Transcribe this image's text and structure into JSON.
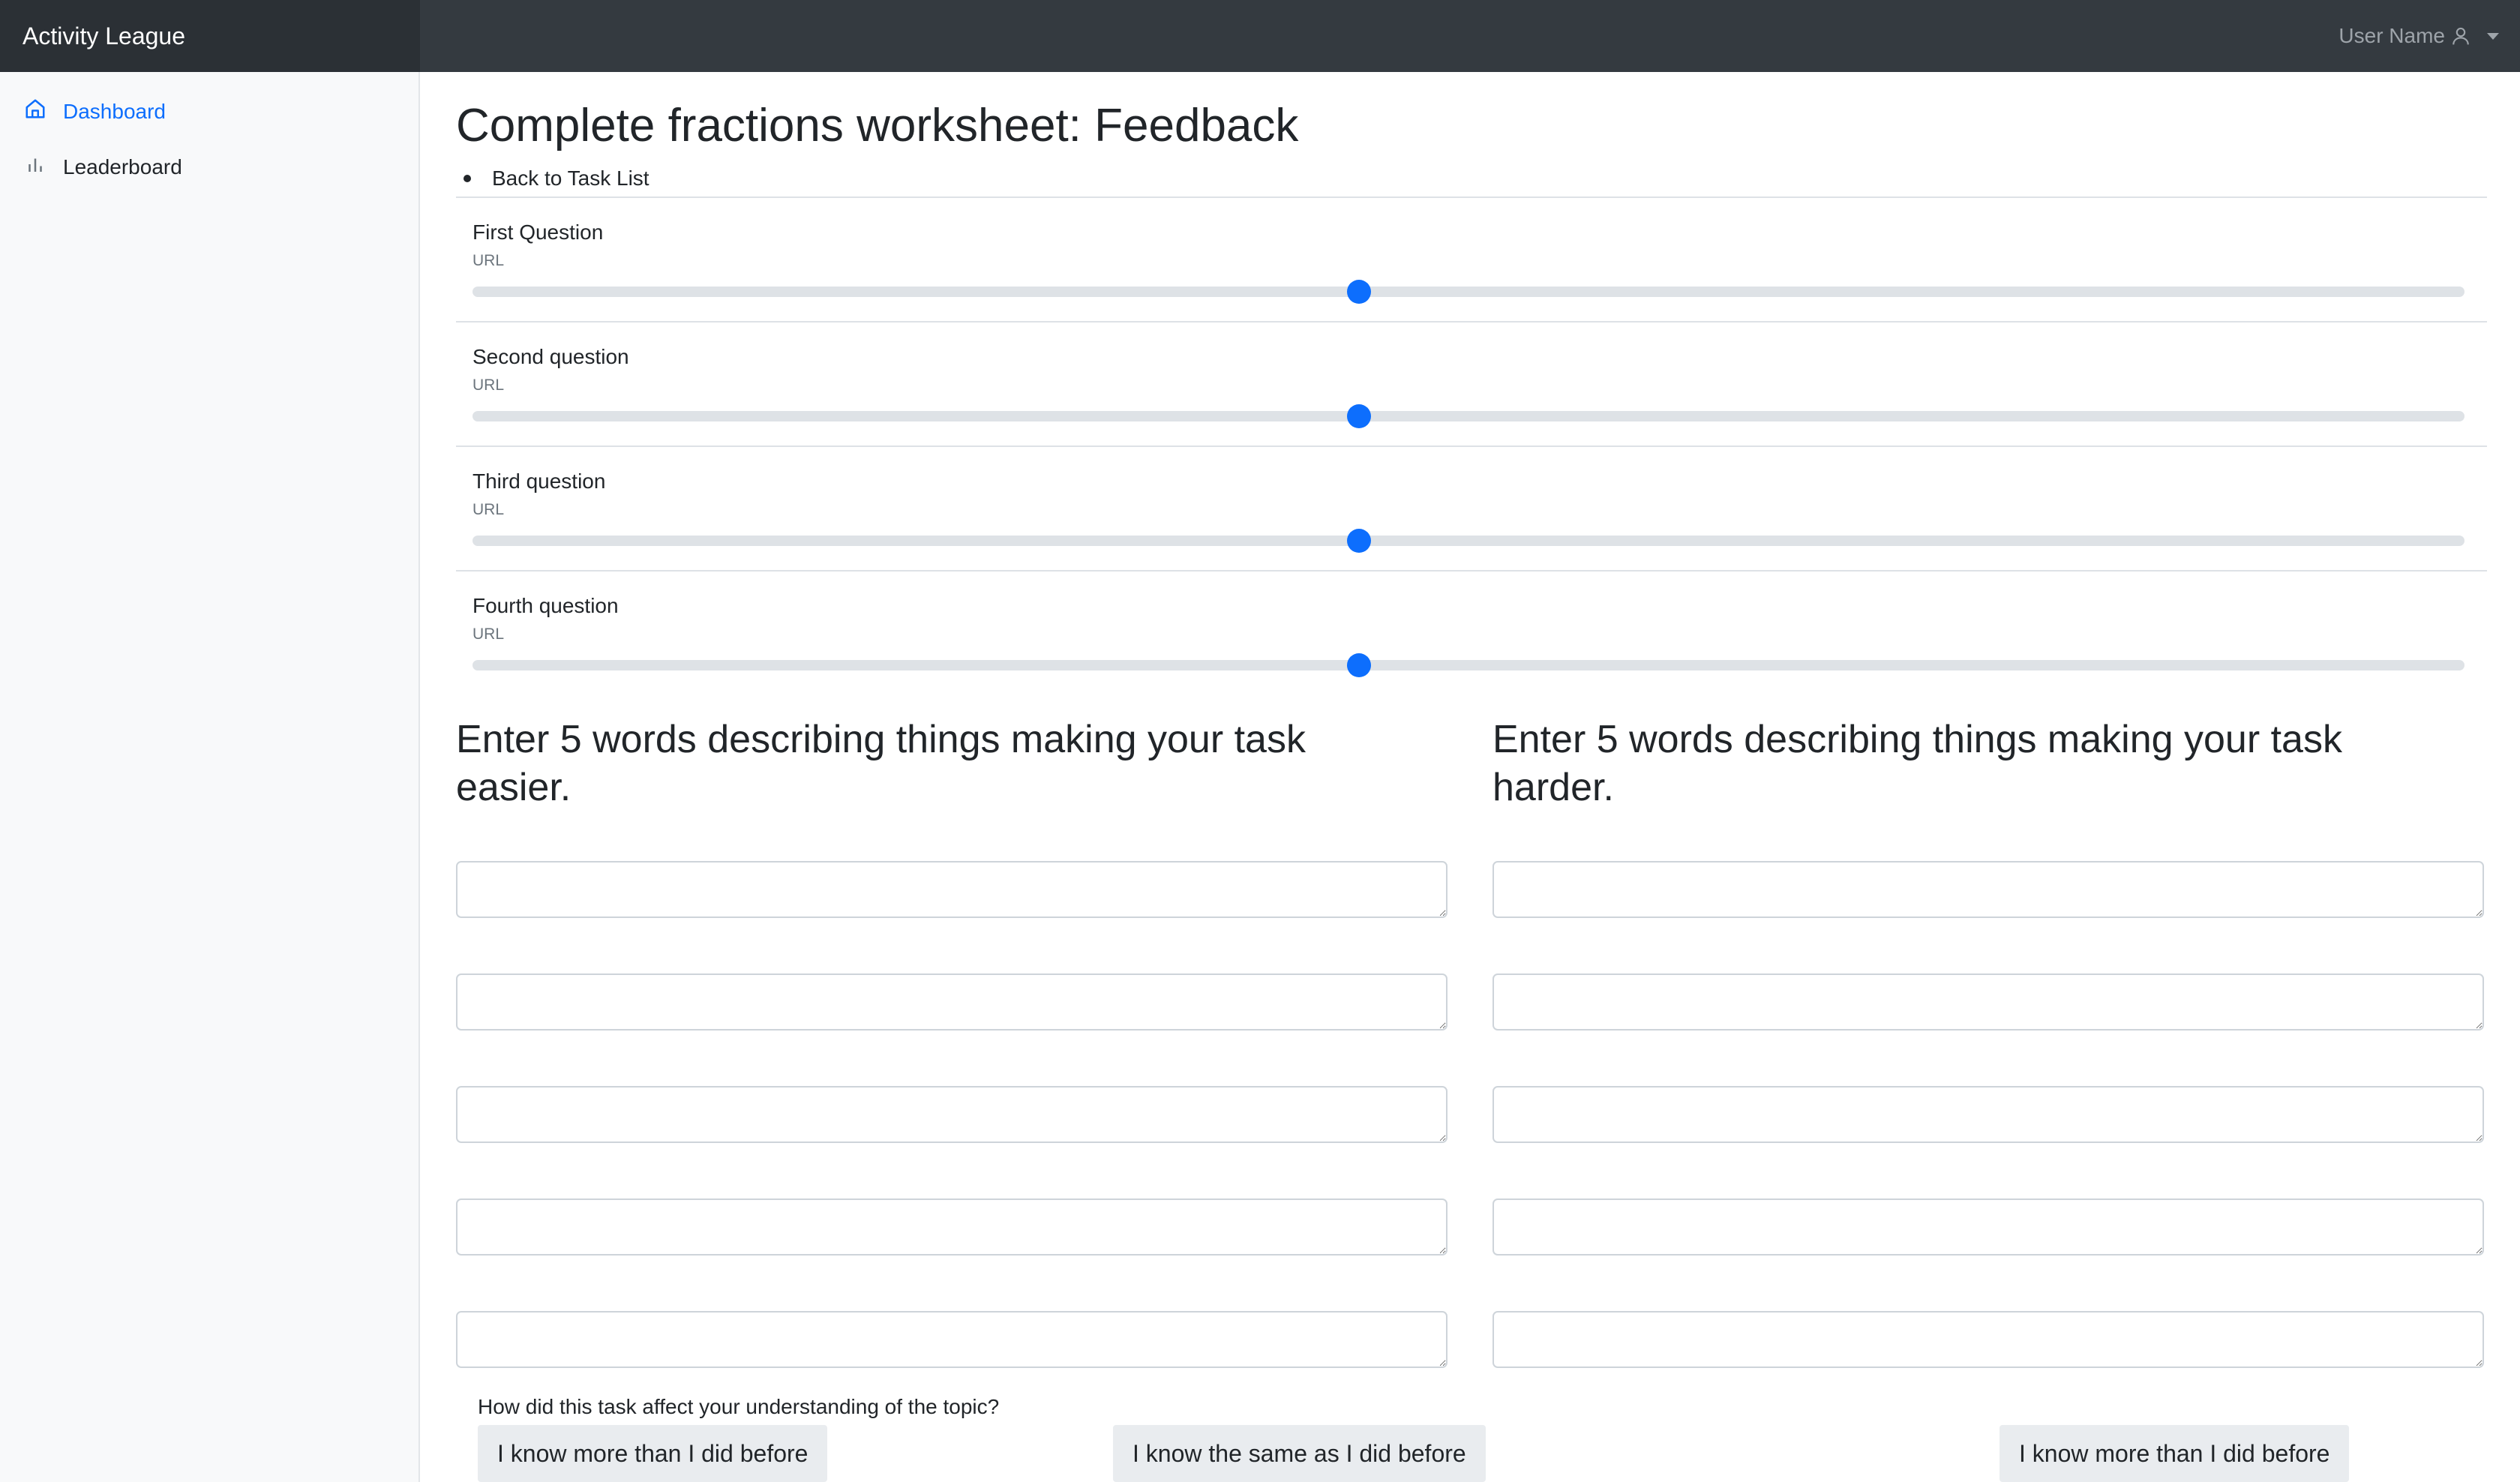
{
  "brand": "Activity League",
  "user": {
    "name": "User Name"
  },
  "sidebar": {
    "items": [
      {
        "label": "Dashboard",
        "icon": "house-icon",
        "active": true
      },
      {
        "label": "Leaderboard",
        "icon": "bar-chart-icon",
        "active": false
      }
    ]
  },
  "page": {
    "title": "Complete fractions worksheet: Feedback",
    "back_link": "Back to Task List"
  },
  "questions": [
    {
      "label": "First Question",
      "sublabel": "URL",
      "value": 0.445
    },
    {
      "label": "Second question",
      "sublabel": "URL",
      "value": 0.445
    },
    {
      "label": "Third question",
      "sublabel": "URL",
      "value": 0.445
    },
    {
      "label": "Fourth question",
      "sublabel": "URL",
      "value": 0.445
    }
  ],
  "words": {
    "easier_heading": "Enter 5 words describing things making your task easier.",
    "harder_heading": "Enter 5 words describing things making your task harder.",
    "easier_values": [
      "",
      "",
      "",
      "",
      ""
    ],
    "harder_values": [
      "",
      "",
      "",
      "",
      ""
    ]
  },
  "understanding": {
    "prompt": "How did this task affect your understanding of the topic?",
    "options": [
      "I know more than I did before",
      "I know the same as I did before",
      "I know more than I did before"
    ]
  },
  "colors": {
    "accent": "#0d6efd",
    "navbar": "#343a40",
    "sidebar": "#f8f9fa"
  }
}
